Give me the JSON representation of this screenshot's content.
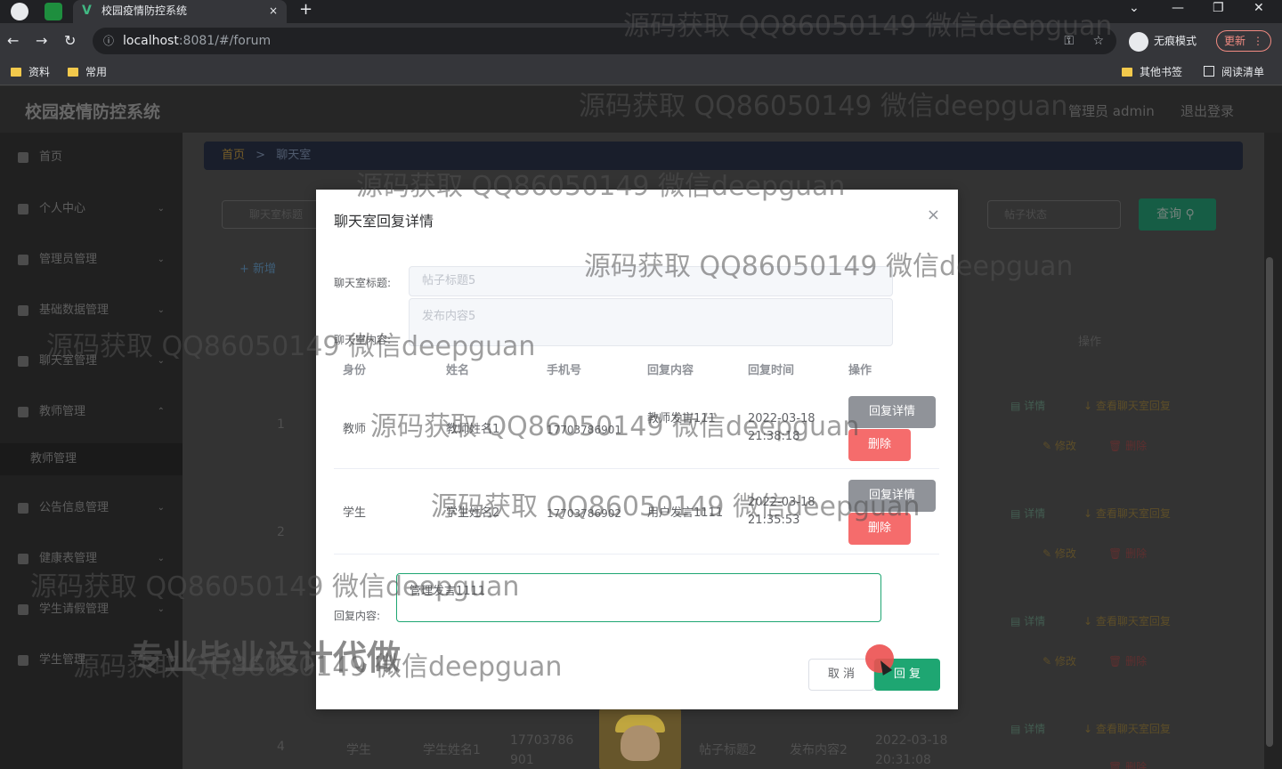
{
  "browser": {
    "tab_title": "校园疫情防控系统",
    "tab_close": "×",
    "new_tab": "+",
    "url_host": "localhost",
    "url_rest": ":8081/#/forum",
    "incognito_label": "无痕模式",
    "update_label": "更新",
    "bookmarks": [
      "资料",
      "常用"
    ],
    "other_bookmarks": "其他书签",
    "reading_list": "阅读清单"
  },
  "app": {
    "title": "校园疫情防控系统",
    "user": "管理员 admin",
    "logout": "退出登录"
  },
  "sidebar": {
    "items": [
      {
        "label": "首页"
      },
      {
        "label": "个人中心"
      },
      {
        "label": "管理员管理"
      },
      {
        "label": "基础数据管理"
      },
      {
        "label": "聊天室管理"
      },
      {
        "label": "教师管理"
      },
      {
        "label": "公告信息管理"
      },
      {
        "label": "健康表管理"
      },
      {
        "label": "学生请假管理"
      },
      {
        "label": "学生管理"
      }
    ],
    "sub_items": [
      "教师管理"
    ]
  },
  "breadcrumb": {
    "home": "首页",
    "sep": ">",
    "current": "聊天室"
  },
  "search": {
    "title_placeholder": "聊天室标题",
    "other_placeholder": "帖子状态",
    "query_label": "查询"
  },
  "add_label": "+ 新增",
  "table_bg": {
    "op_header": "操作",
    "rows": [
      {
        "index": "1"
      },
      {
        "index": "2"
      },
      {
        "index": "4",
        "role": "学生",
        "name": "学生姓名1",
        "phone": "17703786901",
        "title": "帖子标题2",
        "content": "发布内容2",
        "time": "2022-03-18 20:31:08"
      }
    ],
    "op_detail": "详情",
    "op_reply": "查看聊天室回复",
    "op_edit": "修改",
    "op_delete": "删除"
  },
  "dialog": {
    "title": "聊天室回复详情",
    "close": "×",
    "title_label": "聊天室标题:",
    "title_value": "帖子标题5",
    "content_label": "聊天室内容:",
    "content_value": "发布内容5",
    "headers": [
      "身份",
      "姓名",
      "手机号",
      "回复内容",
      "回复时间",
      "操作"
    ],
    "rows": [
      {
        "role": "教师",
        "name": "教师姓名1",
        "phone": "17703786901",
        "content": "教师发言111",
        "time": "2022-03-18 21:38:18",
        "detail_btn": "回复详情",
        "delete_btn": "删除"
      },
      {
        "role": "学生",
        "name": "学生姓名2",
        "phone": "17703786902",
        "content": "用户发言1111",
        "time": "2022-03-18 21:35:53",
        "detail_btn": "回复详情",
        "delete_btn": "删除"
      }
    ],
    "reply_label": "回复内容:",
    "reply_value": "管理发言1111",
    "cancel_label": "取 消",
    "reply_btn": "回 复"
  },
  "watermarks": {
    "text": "源码获取 QQ86050149 微信deepguan",
    "promo": "专业毕业设计代做"
  }
}
